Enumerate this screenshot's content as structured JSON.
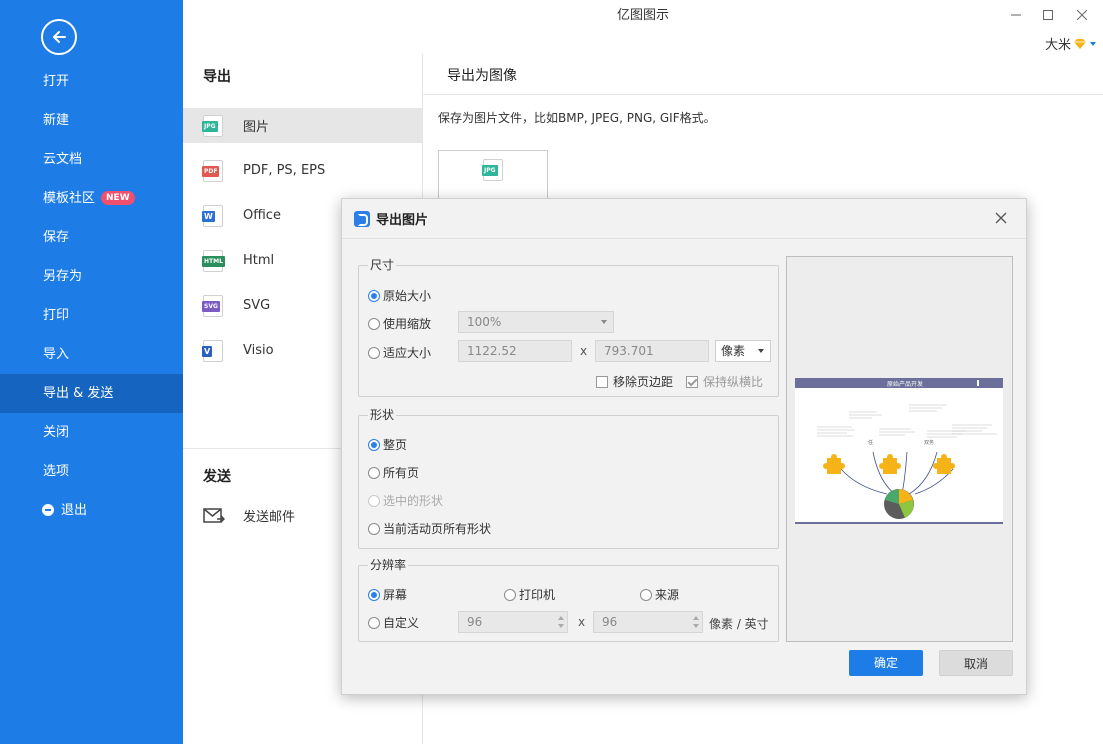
{
  "window": {
    "title": "亿图图示",
    "user_name": "大米"
  },
  "sidebar": {
    "items": [
      {
        "label": "打开"
      },
      {
        "label": "新建"
      },
      {
        "label": "云文档"
      },
      {
        "label": "模板社区",
        "badge": "NEW"
      },
      {
        "label": "保存"
      },
      {
        "label": "另存为"
      },
      {
        "label": "打印"
      },
      {
        "label": "导入"
      },
      {
        "label": "导出 & 发送",
        "active": true
      },
      {
        "label": "关闭"
      },
      {
        "label": "选项"
      },
      {
        "label": "退出"
      }
    ]
  },
  "export_pane": {
    "heading": "导出",
    "formats": [
      {
        "label": "图片",
        "tag": "JPG",
        "tag_color": "#2fb59a",
        "active": true
      },
      {
        "label": "PDF, PS, EPS",
        "tag": "PDF",
        "tag_color": "#e05a50"
      },
      {
        "label": "Office",
        "tag": "W",
        "tag_color": "#2b6fd8"
      },
      {
        "label": "Html",
        "tag": "HTML",
        "tag_color": "#2a8f5c"
      },
      {
        "label": "SVG",
        "tag": "SVG",
        "tag_color": "#7a5cc4"
      },
      {
        "label": "Visio",
        "tag": "V",
        "tag_color": "#2b5fc0"
      }
    ],
    "send_heading": "发送",
    "send_email_label": "发送邮件"
  },
  "right_pane": {
    "heading": "导出为图像",
    "description": "保存为图片文件，比如BMP, JPEG, PNG, GIF格式。",
    "thumb_tag": "JPG"
  },
  "dialog": {
    "title": "导出图片",
    "size_group": {
      "legend": "尺寸",
      "options": [
        "原始大小",
        "使用缩放",
        "适应大小"
      ],
      "selected": 0,
      "zoom_value": "100%",
      "fit_width": "1122.52",
      "fit_height": "793.701",
      "unit": "像素",
      "x_label": "x",
      "remove_margin_label": "移除页边距",
      "keep_ratio_label": "保持纵横比"
    },
    "shape_group": {
      "legend": "形状",
      "options": [
        "整页",
        "所有页",
        "选中的形状",
        "当前活动页所有形状"
      ],
      "selected": 0
    },
    "resolution_group": {
      "legend": "分辨率",
      "options": [
        "屏幕",
        "打印机",
        "来源",
        "自定义"
      ],
      "selected": 0,
      "dpi_x": "96",
      "dpi_y": "96",
      "x_label": "x",
      "unit": "像素 / 英寸"
    },
    "ok_label": "确定",
    "cancel_label": "取消",
    "preview": {
      "header_text": "原始产品开发",
      "center_labels": [
        "任",
        "双务"
      ]
    }
  },
  "colors": {
    "sidebar_bg": "#1e7ce6",
    "accent": "#1e7ce6",
    "new_badge": "#f0506e",
    "puzzle": "#f5b318",
    "preview_bar": "#6b6f99"
  }
}
